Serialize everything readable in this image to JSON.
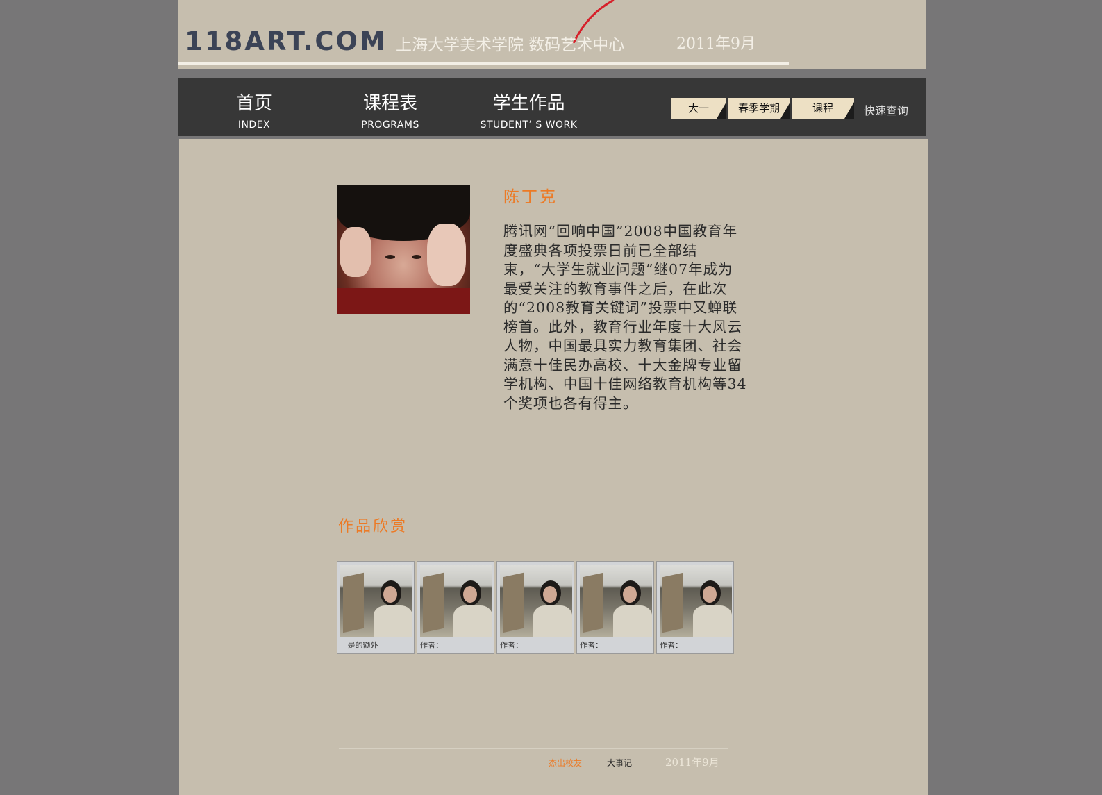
{
  "header": {
    "logo": "118ART.COM",
    "subtitle": "上海大学美术学院  数码艺术中心",
    "date": "2011年9月"
  },
  "nav": {
    "items": [
      {
        "zh": "首页",
        "en": "INDEX"
      },
      {
        "zh": "课程表",
        "en": "PROGRAMS"
      },
      {
        "zh": "学生作品",
        "en": "STUDENT’ S WORK"
      }
    ],
    "filters": [
      "大一",
      "春季学期",
      "课程"
    ],
    "quick_search": "快速查询"
  },
  "profile": {
    "name": "陈丁克",
    "bio": "腾讯网“回响中国”2008中国教育年度盛典各项投票日前已全部结束，“大学生就业问题”继07年成为最受关注的教育事件之后，在此次的“2008教育关键词”投票中又蝉联榜首。此外，教育行业年度十大风云人物，中国最具实力教育集团、社会满意十佳民办高校、十大金牌专业留学机构、中国十佳网络教育机构等34个奖项也各有得主。"
  },
  "gallery": {
    "title": "作品欣赏",
    "cards": [
      {
        "caption": "   是的额外"
      },
      {
        "caption": "作者："
      },
      {
        "caption": "作者："
      },
      {
        "caption": "作者："
      },
      {
        "caption": "作者："
      }
    ]
  },
  "footer": {
    "link1": "杰出校友",
    "link2": "大事记",
    "date": "2011年9月"
  },
  "colors": {
    "page_bg": "#777677",
    "panel_bg": "#c6beae",
    "nav_bg": "#373737",
    "accent": "#ec7a25",
    "filter_bg": "#ede0c4"
  }
}
